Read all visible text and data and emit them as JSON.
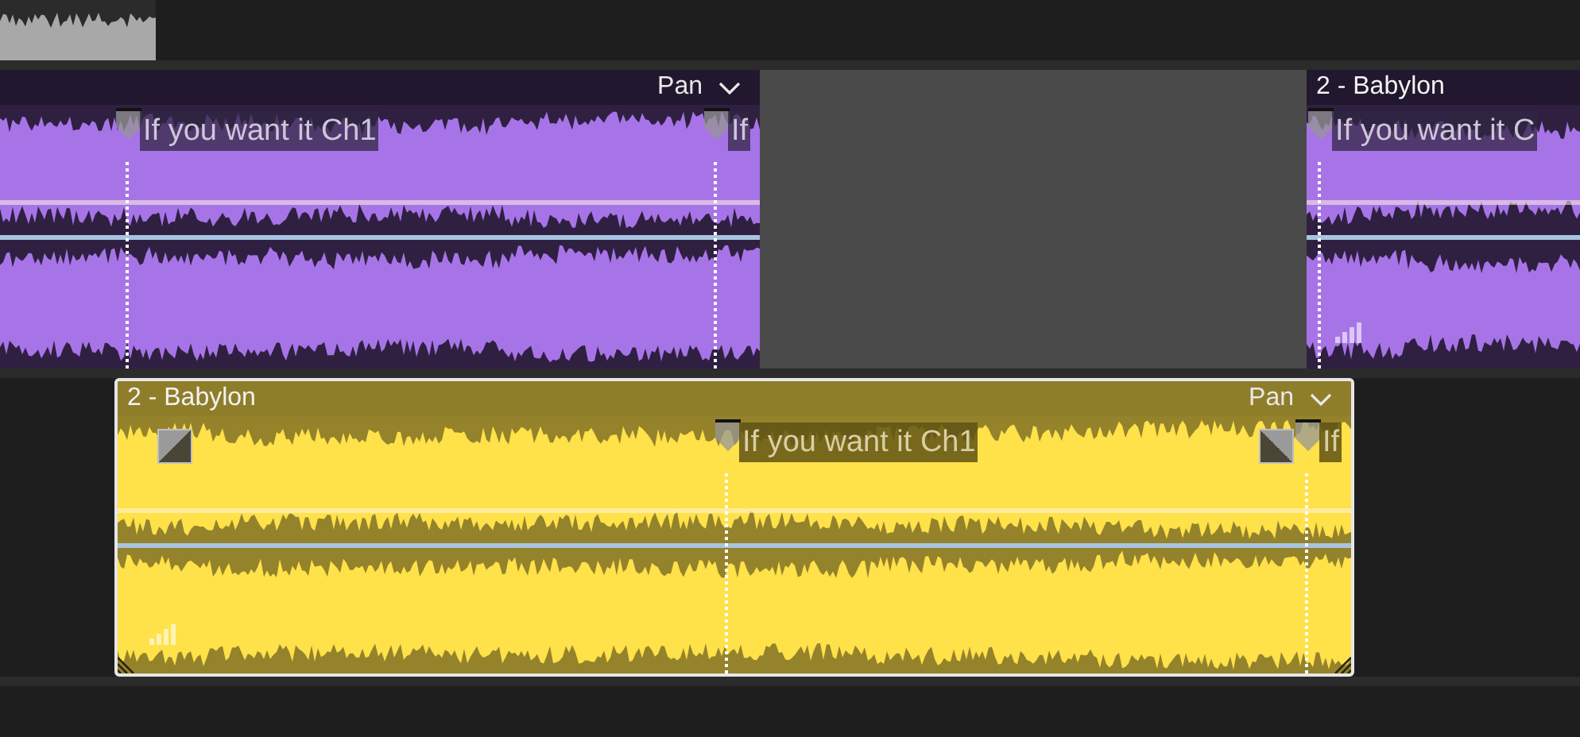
{
  "tracks": [
    {
      "clips": [
        {
          "color": "#a8a8a8",
          "selected": false
        }
      ]
    },
    {
      "clips": [
        {
          "color": "#a774e8",
          "selected": false,
          "pan": "Pan",
          "markers": [
            {
              "label": "If you want it Ch1"
            },
            {
              "label": "If"
            }
          ]
        },
        {
          "color": "#a774e8",
          "selected": false,
          "meter_icon": true,
          "title": "2 - Babylon",
          "markers": [
            {
              "label": "If you want it C"
            }
          ]
        }
      ]
    },
    {
      "clips": [
        {
          "color": "#ffe14a",
          "selected": true,
          "meter_icon": true,
          "title": "2 - Babylon",
          "pan": "Pan",
          "fade_in": true,
          "fade_out": true,
          "markers": [
            {
              "label": "If you want it Ch1"
            },
            {
              "label": "If"
            }
          ]
        }
      ]
    }
  ]
}
